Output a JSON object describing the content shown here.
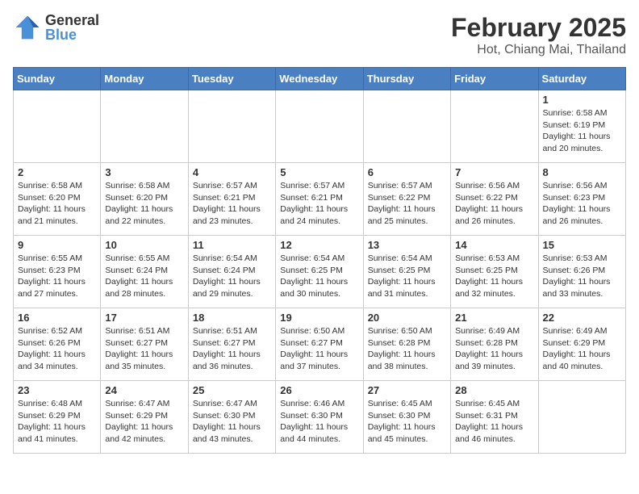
{
  "logo": {
    "general": "General",
    "blue": "Blue"
  },
  "header": {
    "month": "February 2025",
    "location": "Hot, Chiang Mai, Thailand"
  },
  "weekdays": [
    "Sunday",
    "Monday",
    "Tuesday",
    "Wednesday",
    "Thursday",
    "Friday",
    "Saturday"
  ],
  "weeks": [
    [
      {
        "day": "",
        "info": ""
      },
      {
        "day": "",
        "info": ""
      },
      {
        "day": "",
        "info": ""
      },
      {
        "day": "",
        "info": ""
      },
      {
        "day": "",
        "info": ""
      },
      {
        "day": "",
        "info": ""
      },
      {
        "day": "1",
        "info": "Sunrise: 6:58 AM\nSunset: 6:19 PM\nDaylight: 11 hours\nand 20 minutes."
      }
    ],
    [
      {
        "day": "2",
        "info": "Sunrise: 6:58 AM\nSunset: 6:20 PM\nDaylight: 11 hours\nand 21 minutes."
      },
      {
        "day": "3",
        "info": "Sunrise: 6:58 AM\nSunset: 6:20 PM\nDaylight: 11 hours\nand 22 minutes."
      },
      {
        "day": "4",
        "info": "Sunrise: 6:57 AM\nSunset: 6:21 PM\nDaylight: 11 hours\nand 23 minutes."
      },
      {
        "day": "5",
        "info": "Sunrise: 6:57 AM\nSunset: 6:21 PM\nDaylight: 11 hours\nand 24 minutes."
      },
      {
        "day": "6",
        "info": "Sunrise: 6:57 AM\nSunset: 6:22 PM\nDaylight: 11 hours\nand 25 minutes."
      },
      {
        "day": "7",
        "info": "Sunrise: 6:56 AM\nSunset: 6:22 PM\nDaylight: 11 hours\nand 26 minutes."
      },
      {
        "day": "8",
        "info": "Sunrise: 6:56 AM\nSunset: 6:23 PM\nDaylight: 11 hours\nand 26 minutes."
      }
    ],
    [
      {
        "day": "9",
        "info": "Sunrise: 6:55 AM\nSunset: 6:23 PM\nDaylight: 11 hours\nand 27 minutes."
      },
      {
        "day": "10",
        "info": "Sunrise: 6:55 AM\nSunset: 6:24 PM\nDaylight: 11 hours\nand 28 minutes."
      },
      {
        "day": "11",
        "info": "Sunrise: 6:54 AM\nSunset: 6:24 PM\nDaylight: 11 hours\nand 29 minutes."
      },
      {
        "day": "12",
        "info": "Sunrise: 6:54 AM\nSunset: 6:25 PM\nDaylight: 11 hours\nand 30 minutes."
      },
      {
        "day": "13",
        "info": "Sunrise: 6:54 AM\nSunset: 6:25 PM\nDaylight: 11 hours\nand 31 minutes."
      },
      {
        "day": "14",
        "info": "Sunrise: 6:53 AM\nSunset: 6:25 PM\nDaylight: 11 hours\nand 32 minutes."
      },
      {
        "day": "15",
        "info": "Sunrise: 6:53 AM\nSunset: 6:26 PM\nDaylight: 11 hours\nand 33 minutes."
      }
    ],
    [
      {
        "day": "16",
        "info": "Sunrise: 6:52 AM\nSunset: 6:26 PM\nDaylight: 11 hours\nand 34 minutes."
      },
      {
        "day": "17",
        "info": "Sunrise: 6:51 AM\nSunset: 6:27 PM\nDaylight: 11 hours\nand 35 minutes."
      },
      {
        "day": "18",
        "info": "Sunrise: 6:51 AM\nSunset: 6:27 PM\nDaylight: 11 hours\nand 36 minutes."
      },
      {
        "day": "19",
        "info": "Sunrise: 6:50 AM\nSunset: 6:27 PM\nDaylight: 11 hours\nand 37 minutes."
      },
      {
        "day": "20",
        "info": "Sunrise: 6:50 AM\nSunset: 6:28 PM\nDaylight: 11 hours\nand 38 minutes."
      },
      {
        "day": "21",
        "info": "Sunrise: 6:49 AM\nSunset: 6:28 PM\nDaylight: 11 hours\nand 39 minutes."
      },
      {
        "day": "22",
        "info": "Sunrise: 6:49 AM\nSunset: 6:29 PM\nDaylight: 11 hours\nand 40 minutes."
      }
    ],
    [
      {
        "day": "23",
        "info": "Sunrise: 6:48 AM\nSunset: 6:29 PM\nDaylight: 11 hours\nand 41 minutes."
      },
      {
        "day": "24",
        "info": "Sunrise: 6:47 AM\nSunset: 6:29 PM\nDaylight: 11 hours\nand 42 minutes."
      },
      {
        "day": "25",
        "info": "Sunrise: 6:47 AM\nSunset: 6:30 PM\nDaylight: 11 hours\nand 43 minutes."
      },
      {
        "day": "26",
        "info": "Sunrise: 6:46 AM\nSunset: 6:30 PM\nDaylight: 11 hours\nand 44 minutes."
      },
      {
        "day": "27",
        "info": "Sunrise: 6:45 AM\nSunset: 6:30 PM\nDaylight: 11 hours\nand 45 minutes."
      },
      {
        "day": "28",
        "info": "Sunrise: 6:45 AM\nSunset: 6:31 PM\nDaylight: 11 hours\nand 46 minutes."
      },
      {
        "day": "",
        "info": ""
      }
    ]
  ]
}
